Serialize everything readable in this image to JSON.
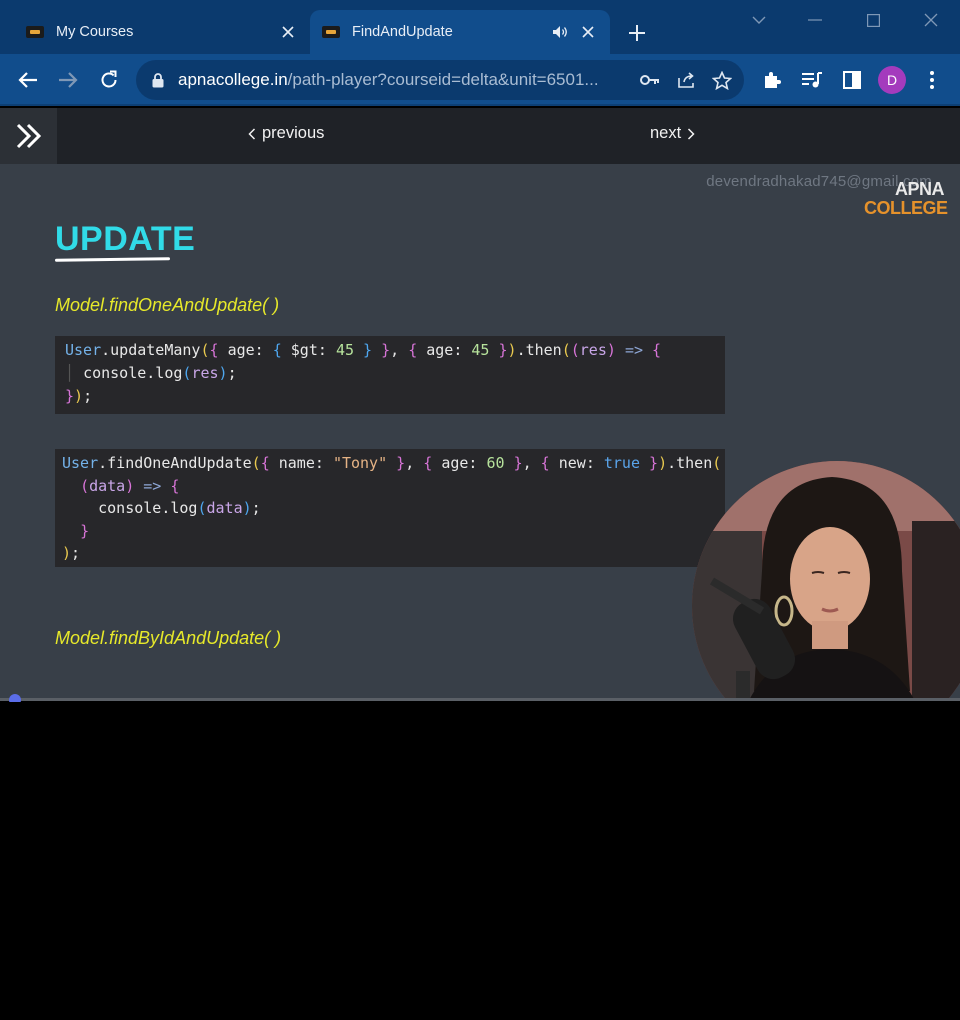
{
  "browser": {
    "tabs": [
      {
        "title": "My Courses",
        "active": false
      },
      {
        "title": "FindAndUpdate",
        "active": true,
        "audio": true
      }
    ],
    "url": {
      "host": "apnacollege.in",
      "path": "/path-player?courseid=delta&unit=6501..."
    },
    "profile_initial": "D",
    "colors": {
      "frame": "#0b3a6e",
      "toolbar": "#114d8c",
      "avatar": "#a43bbd"
    }
  },
  "player_nav": {
    "previous_label": "previous",
    "next_label": "next"
  },
  "video": {
    "watermark_email": "devendradhakad745@gmail.com",
    "brand_line1": "APNA",
    "brand_line2": "COLLEGE",
    "slide_title": "UPDATE",
    "methods": [
      "Model.findOneAndUpdate( )",
      "Model.findByIdAndUpdate( )"
    ],
    "code1": {
      "obj": "User",
      "call": ".updateMany",
      "k_age": "age",
      "op": "$gt",
      "num45": "45",
      "then": ".then",
      "param": "res",
      "log_obj": "console",
      "log_fn": ".log"
    },
    "code2": {
      "obj": "User",
      "call": ".findOneAndUpdate",
      "k_name": "name",
      "str_tony": "\"Tony\"",
      "k_age": "age",
      "num60": "60",
      "k_new": "new",
      "kw_true": "true",
      "then": ".then",
      "param": "data",
      "log_obj": "console",
      "log_fn": ".log"
    },
    "colors": {
      "background": "#383f48",
      "title": "#31dbe8",
      "method": "#e7e92a",
      "code_bg": "#27272a"
    },
    "progress_fraction": 0.01
  }
}
